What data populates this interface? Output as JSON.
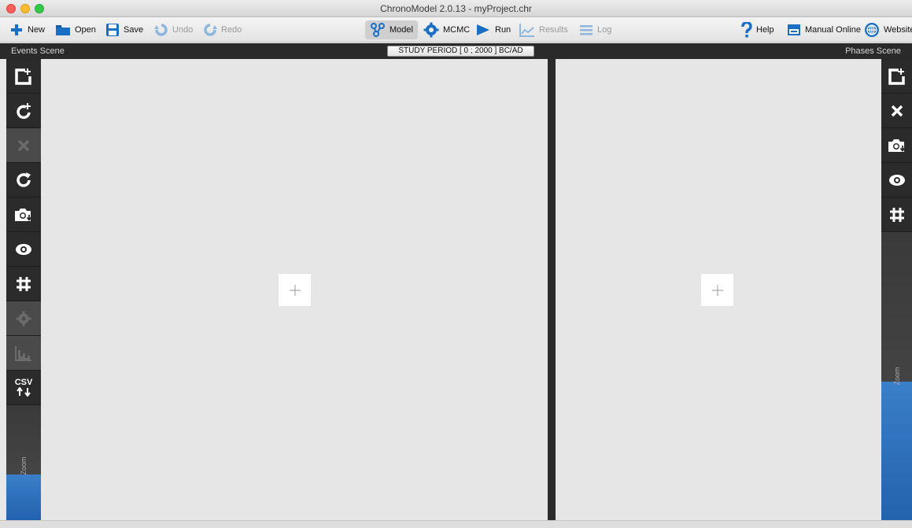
{
  "window": {
    "title": "ChronoModel 2.0.13 - myProject.chr"
  },
  "toolbar": {
    "new": "New",
    "open": "Open",
    "save": "Save",
    "undo": "Undo",
    "redo": "Redo",
    "model": "Model",
    "mcmc": "MCMC",
    "run": "Run",
    "results": "Results",
    "log": "Log",
    "help": "Help",
    "manual": "Manual Online",
    "website": "Website"
  },
  "scenes": {
    "events_title": "Events Scene",
    "phases_title": "Phases Scene",
    "study_period": "STUDY PERIOD [ 0 ; 2000 ] BC/AD"
  },
  "left_tools": {
    "csv": "CSV",
    "zoom_label": "Zoom",
    "zoom_level": 0.4
  },
  "right_tools": {
    "zoom_label": "Zoom",
    "zoom_level": 0.48
  },
  "colors": {
    "accent": "#2a6bb8",
    "toolbar_icon": "#1a6fc4",
    "sidebar": "#2b2b2b"
  }
}
